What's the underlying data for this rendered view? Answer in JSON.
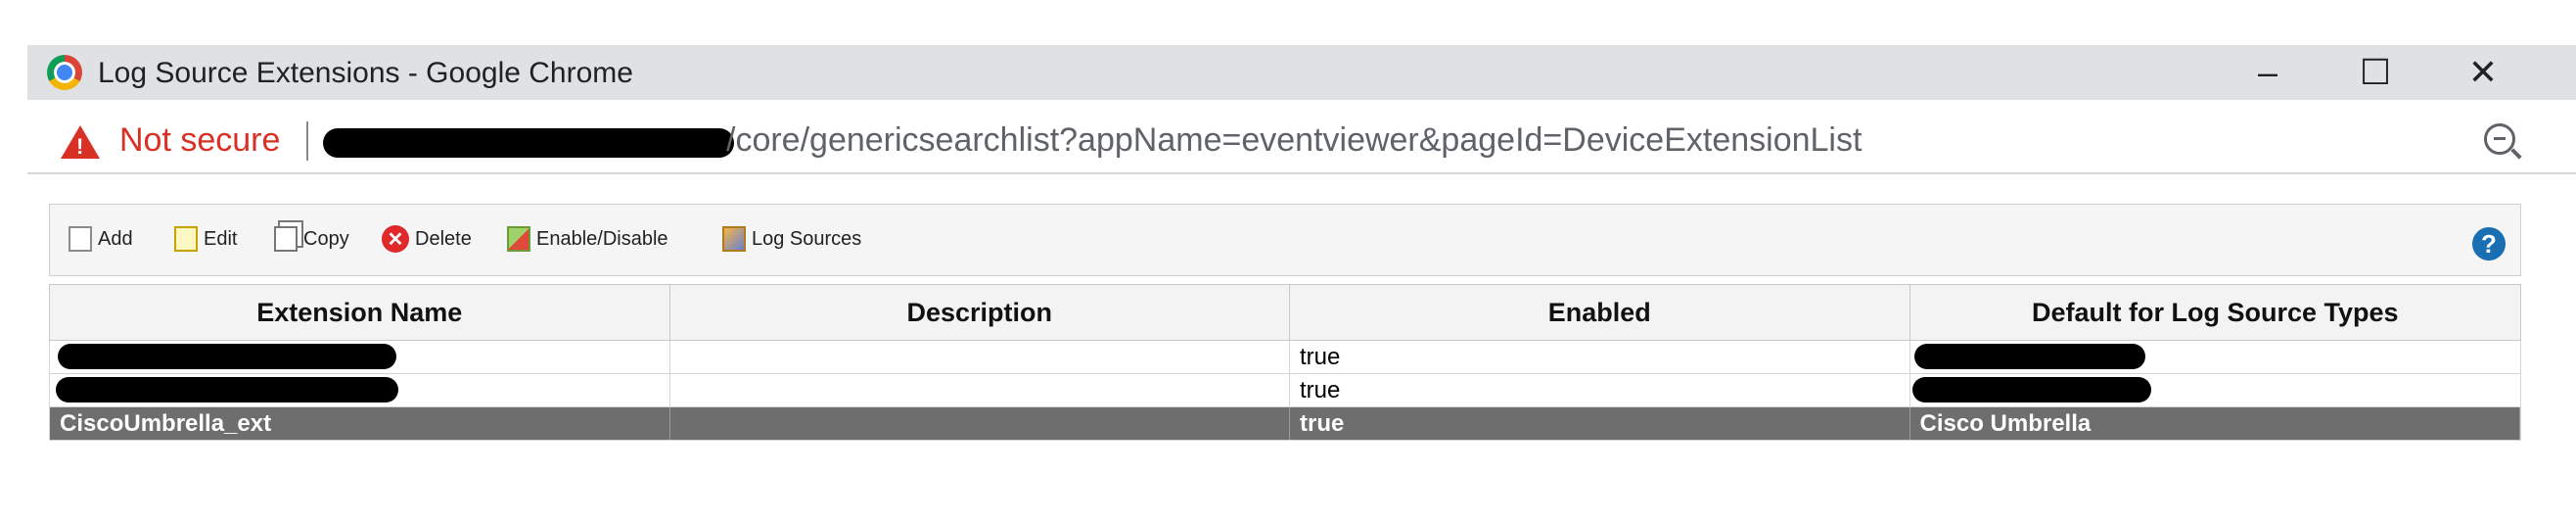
{
  "window": {
    "title": "Log Source Extensions - Google Chrome",
    "controls": {
      "minimize": "–",
      "maximize": "☐",
      "close": "✕"
    }
  },
  "address_bar": {
    "security_label": "Not secure",
    "url_visible": "/core/genericsearchlist?appName=eventviewer&pageId=DeviceExtensionList"
  },
  "toolbar": {
    "items": [
      {
        "label": "Add",
        "icon": "document-icon"
      },
      {
        "label": "Edit",
        "icon": "edit-icon"
      },
      {
        "label": "Copy",
        "icon": "copy-icon"
      },
      {
        "label": "Delete",
        "icon": "delete-icon"
      },
      {
        "label": "Enable/Disable",
        "icon": "enable-disable-icon"
      },
      {
        "label": "Log Sources",
        "icon": "log-sources-icon"
      }
    ],
    "help": "?"
  },
  "table": {
    "columns": [
      "Extension Name",
      "Description",
      "Enabled",
      "Default for Log Source Types"
    ],
    "rows": [
      {
        "name": "",
        "description": "",
        "enabled": "true",
        "default_type": ""
      },
      {
        "name": "",
        "description": "",
        "enabled": "true",
        "default_type": ""
      },
      {
        "name": "CiscoUmbrella_ext",
        "description": "",
        "enabled": "true",
        "default_type": "Cisco Umbrella"
      }
    ]
  }
}
